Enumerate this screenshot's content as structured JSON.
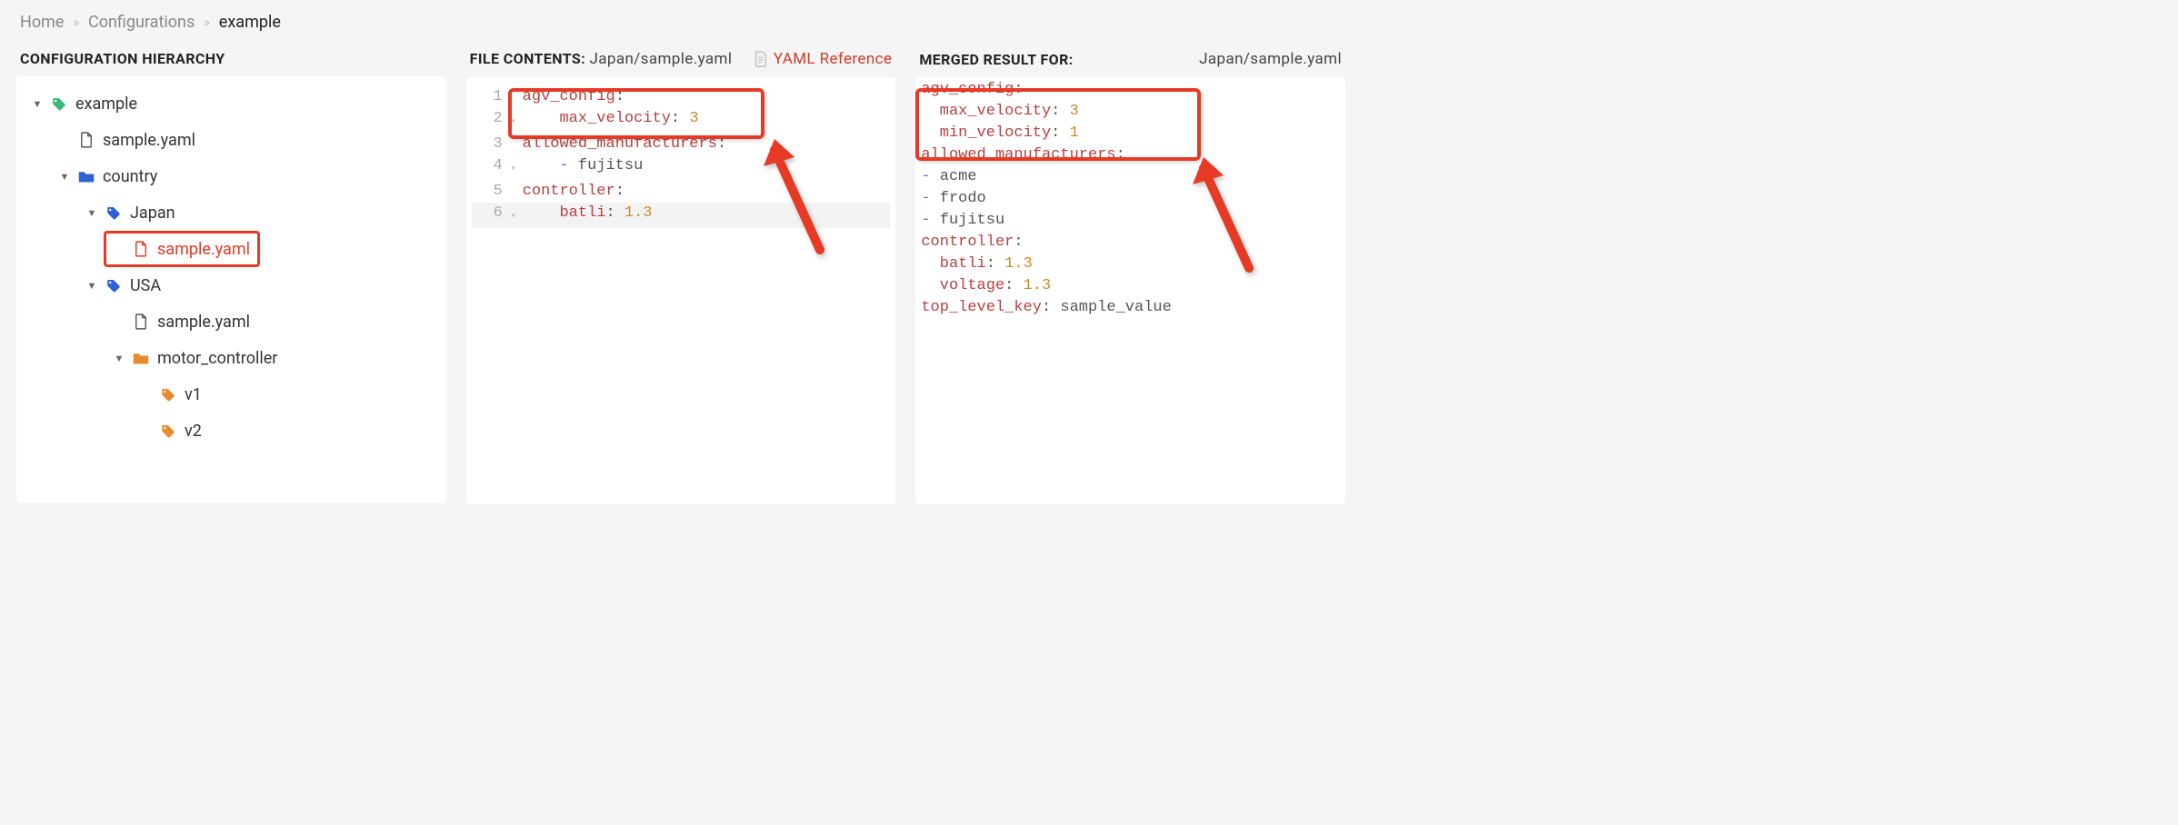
{
  "breadcrumb": {
    "items": [
      "Home",
      "Configurations",
      "example"
    ]
  },
  "hierarchy": {
    "title": "CONFIGURATION HIERARCHY",
    "nodes": [
      {
        "label": "example",
        "icon": "tag",
        "color": "#3cb878",
        "caret": true,
        "indent": 0
      },
      {
        "label": "sample.yaml",
        "icon": "file",
        "color": "#555",
        "caret": false,
        "indent": 1
      },
      {
        "label": "country",
        "icon": "folder",
        "color": "#2c64d6",
        "caret": true,
        "indent": 1
      },
      {
        "label": "Japan",
        "icon": "tag",
        "color": "#2c64d6",
        "caret": true,
        "indent": 2
      },
      {
        "label": "sample.yaml",
        "icon": "file",
        "color": "#e63a24",
        "caret": false,
        "indent": 3,
        "selected": true
      },
      {
        "label": "USA",
        "icon": "tag",
        "color": "#2c64d6",
        "caret": true,
        "indent": 2
      },
      {
        "label": "sample.yaml",
        "icon": "file",
        "color": "#555",
        "caret": false,
        "indent": 3
      },
      {
        "label": "motor_controller",
        "icon": "folder",
        "color": "#e88b2e",
        "caret": true,
        "indent": 3
      },
      {
        "label": "v1",
        "icon": "tag",
        "color": "#e88b2e",
        "caret": false,
        "indent": 4
      },
      {
        "label": "v2",
        "icon": "tag",
        "color": "#e88b2e",
        "caret": false,
        "indent": 4
      }
    ]
  },
  "file_contents": {
    "title_prefix": "FILE CONTENTS:",
    "path": "Japan/sample.yaml",
    "yaml_reference_label": "YAML Reference",
    "lines": [
      {
        "n": 1,
        "fold": "",
        "tokens": [
          [
            "key",
            "agv_config"
          ],
          [
            "punc",
            ":"
          ]
        ]
      },
      {
        "n": 2,
        "fold": "▾",
        "tokens": [
          [
            "pad",
            "    "
          ],
          [
            "key",
            "max_velocity"
          ],
          [
            "punc",
            ": "
          ],
          [
            "num",
            "3"
          ]
        ]
      },
      {
        "n": 3,
        "fold": "",
        "tokens": [
          [
            "key",
            "allowed_manufacturers"
          ],
          [
            "punc",
            ":"
          ]
        ]
      },
      {
        "n": 4,
        "fold": "▾",
        "tokens": [
          [
            "pad",
            "    "
          ],
          [
            "dash",
            "- "
          ],
          [
            "str",
            "fujitsu"
          ]
        ]
      },
      {
        "n": 5,
        "fold": "",
        "tokens": [
          [
            "key",
            "controller"
          ],
          [
            "punc",
            ":"
          ]
        ]
      },
      {
        "n": 6,
        "fold": "▾",
        "tokens": [
          [
            "pad",
            "    "
          ],
          [
            "key",
            "batli"
          ],
          [
            "punc",
            ": "
          ],
          [
            "num",
            "1.3"
          ]
        ],
        "cursor": true
      }
    ]
  },
  "merged_result": {
    "title": "MERGED RESULT FOR:",
    "path": "Japan/sample.yaml",
    "lines": [
      [
        [
          "key",
          "agv_config"
        ],
        [
          "punc",
          ":"
        ]
      ],
      [
        [
          "pad",
          "  "
        ],
        [
          "key",
          "max_velocity"
        ],
        [
          "punc",
          ": "
        ],
        [
          "num",
          "3"
        ]
      ],
      [
        [
          "pad",
          "  "
        ],
        [
          "key",
          "min_velocity"
        ],
        [
          "punc",
          ": "
        ],
        [
          "num",
          "1"
        ]
      ],
      [
        [
          "key",
          "allowed_manufacturers"
        ],
        [
          "punc",
          ":"
        ]
      ],
      [
        [
          "dash",
          "- "
        ],
        [
          "str",
          "acme"
        ]
      ],
      [
        [
          "dash",
          "- "
        ],
        [
          "str",
          "frodo"
        ]
      ],
      [
        [
          "dash",
          "- "
        ],
        [
          "str",
          "fujitsu"
        ]
      ],
      [
        [
          "key",
          "controller"
        ],
        [
          "punc",
          ":"
        ]
      ],
      [
        [
          "pad",
          "  "
        ],
        [
          "key",
          "batli"
        ],
        [
          "punc",
          ": "
        ],
        [
          "num",
          "1.3"
        ]
      ],
      [
        [
          "pad",
          "  "
        ],
        [
          "key",
          "voltage"
        ],
        [
          "punc",
          ": "
        ],
        [
          "num",
          "1.3"
        ]
      ],
      [
        [
          "key",
          "top_level_key"
        ],
        [
          "punc",
          ": "
        ],
        [
          "str",
          "sample_value"
        ]
      ]
    ]
  }
}
